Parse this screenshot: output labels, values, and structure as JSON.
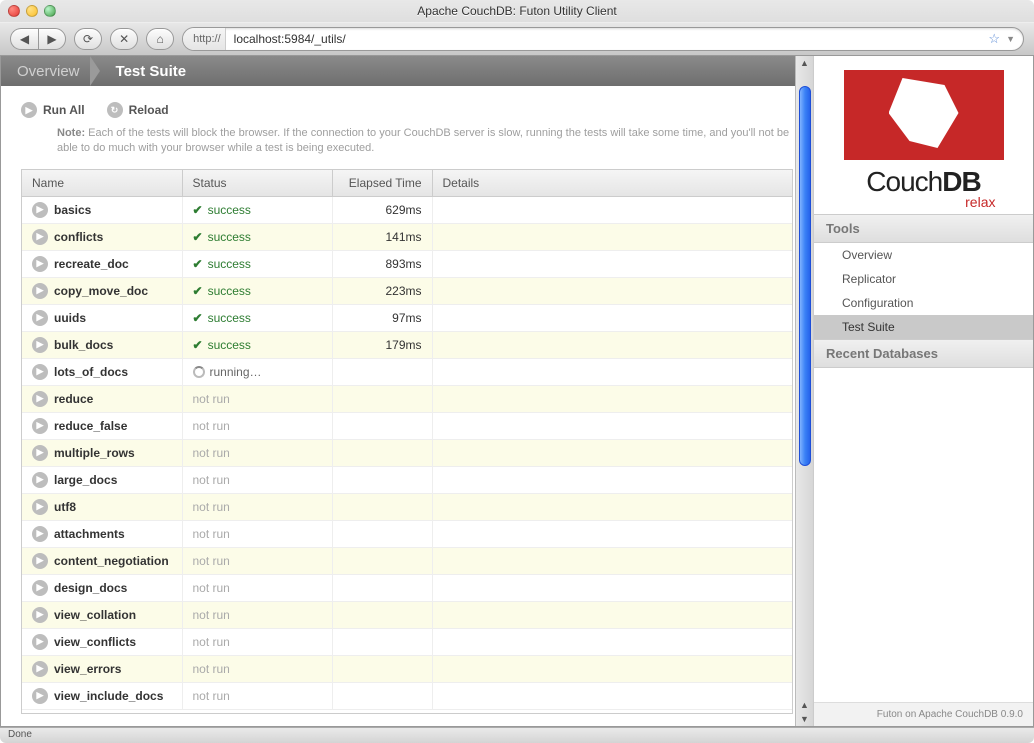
{
  "window": {
    "title": "Apache CouchDB: Futon Utility Client",
    "url_scheme": "http://",
    "url": "localhost:5984/_utils/",
    "status": "Done"
  },
  "breadcrumb": {
    "overview": "Overview",
    "current": "Test Suite"
  },
  "actions": {
    "run_all": "Run All",
    "reload": "Reload"
  },
  "note": {
    "label": "Note:",
    "text": "Each of the tests will block the browser. If the connection to your CouchDB server is slow, running the tests will take some time, and you'll not be able to do much with your browser while a test is being executed."
  },
  "table": {
    "headers": {
      "name": "Name",
      "status": "Status",
      "elapsed": "Elapsed Time",
      "details": "Details"
    },
    "rows": [
      {
        "name": "basics",
        "status": "success",
        "status_label": "success",
        "elapsed": "629ms"
      },
      {
        "name": "conflicts",
        "status": "success",
        "status_label": "success",
        "elapsed": "141ms"
      },
      {
        "name": "recreate_doc",
        "status": "success",
        "status_label": "success",
        "elapsed": "893ms"
      },
      {
        "name": "copy_move_doc",
        "status": "success",
        "status_label": "success",
        "elapsed": "223ms"
      },
      {
        "name": "uuids",
        "status": "success",
        "status_label": "success",
        "elapsed": "97ms"
      },
      {
        "name": "bulk_docs",
        "status": "success",
        "status_label": "success",
        "elapsed": "179ms"
      },
      {
        "name": "lots_of_docs",
        "status": "running",
        "status_label": "running…",
        "elapsed": ""
      },
      {
        "name": "reduce",
        "status": "notrun",
        "status_label": "not run",
        "elapsed": ""
      },
      {
        "name": "reduce_false",
        "status": "notrun",
        "status_label": "not run",
        "elapsed": ""
      },
      {
        "name": "multiple_rows",
        "status": "notrun",
        "status_label": "not run",
        "elapsed": ""
      },
      {
        "name": "large_docs",
        "status": "notrun",
        "status_label": "not run",
        "elapsed": ""
      },
      {
        "name": "utf8",
        "status": "notrun",
        "status_label": "not run",
        "elapsed": ""
      },
      {
        "name": "attachments",
        "status": "notrun",
        "status_label": "not run",
        "elapsed": ""
      },
      {
        "name": "content_negotiation",
        "status": "notrun",
        "status_label": "not run",
        "elapsed": ""
      },
      {
        "name": "design_docs",
        "status": "notrun",
        "status_label": "not run",
        "elapsed": ""
      },
      {
        "name": "view_collation",
        "status": "notrun",
        "status_label": "not run",
        "elapsed": ""
      },
      {
        "name": "view_conflicts",
        "status": "notrun",
        "status_label": "not run",
        "elapsed": ""
      },
      {
        "name": "view_errors",
        "status": "notrun",
        "status_label": "not run",
        "elapsed": ""
      },
      {
        "name": "view_include_docs",
        "status": "notrun",
        "status_label": "not run",
        "elapsed": ""
      }
    ]
  },
  "sidebar": {
    "logo_text_1": "Couch",
    "logo_text_2": "DB",
    "logo_tag": "relax",
    "tools_title": "Tools",
    "tools": [
      {
        "label": "Overview",
        "selected": false
      },
      {
        "label": "Replicator",
        "selected": false
      },
      {
        "label": "Configuration",
        "selected": false
      },
      {
        "label": "Test Suite",
        "selected": true
      }
    ],
    "recent_title": "Recent Databases",
    "footer": "Futon on Apache CouchDB 0.9.0"
  }
}
